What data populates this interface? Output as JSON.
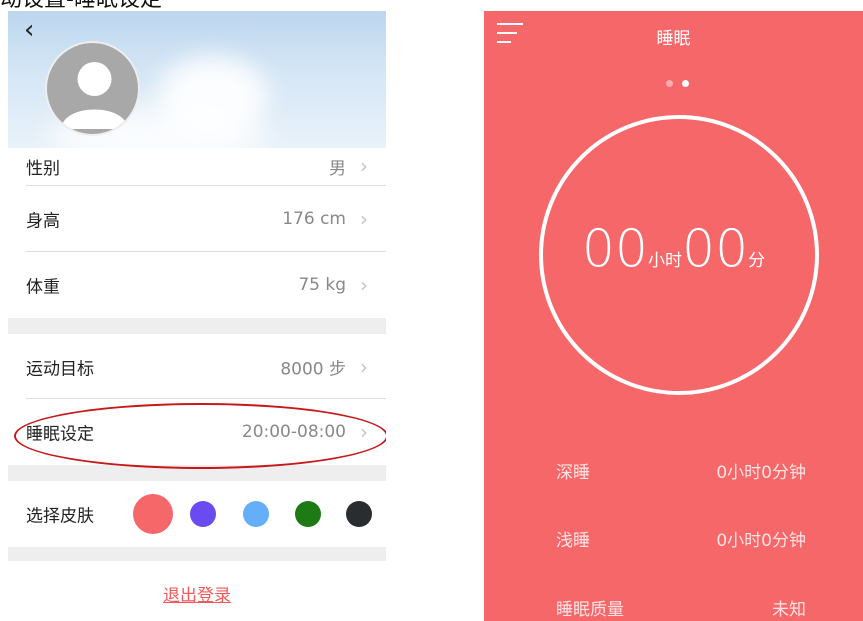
{
  "heading_fragment": "动设置-睡眠设定",
  "profile": {
    "back_glyph": "‹",
    "rows": {
      "gender": {
        "label": "性别",
        "value": "男"
      },
      "height": {
        "label": "身高",
        "value": "176 cm"
      },
      "weight": {
        "label": "体重",
        "value": "75 kg"
      },
      "goal": {
        "label": "运动目标",
        "value": "8000 步"
      },
      "sleep": {
        "label": "睡眠设定",
        "value": "20:00-08:00"
      }
    },
    "chevron": "›",
    "skin": {
      "label": "选择皮肤",
      "colors": [
        "#f6676a",
        "#6a4bf2",
        "#64aefa",
        "#1e7a14",
        "#2a2d2f"
      ]
    },
    "logout_label": "退出登录"
  },
  "sleep": {
    "title": "睡眠",
    "page_dots": {
      "count": 2,
      "active": 1
    },
    "hours": "00",
    "hours_unit": "小时",
    "minutes": "00",
    "minutes_unit": "分",
    "stats": [
      {
        "label": "深睡",
        "value": "0小时0分钟"
      },
      {
        "label": "浅睡",
        "value": "0小时0分钟"
      },
      {
        "label": "睡眠质量",
        "value": "未知"
      }
    ]
  },
  "colors": {
    "accent": "#f6676a",
    "annotation": "#c61a1a"
  }
}
